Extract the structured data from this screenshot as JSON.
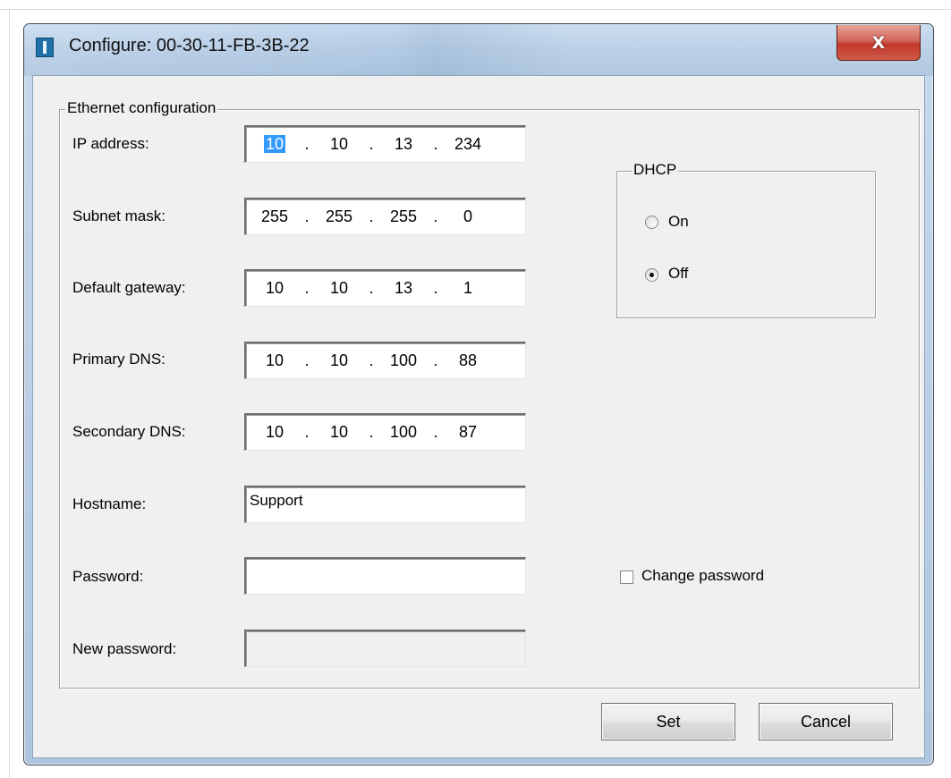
{
  "window": {
    "title": "Configure: 00-30-11-FB-3B-22",
    "close_label": "X"
  },
  "ethernet": {
    "group_label": "Ethernet configuration",
    "ip_address": {
      "label": "IP address:",
      "octets": [
        "10",
        "10",
        "13",
        "234"
      ]
    },
    "subnet_mask": {
      "label": "Subnet mask:",
      "octets": [
        "255",
        "255",
        "255",
        "0"
      ]
    },
    "default_gateway": {
      "label": "Default gateway:",
      "octets": [
        "10",
        "10",
        "13",
        "1"
      ]
    },
    "primary_dns": {
      "label": "Primary DNS:",
      "octets": [
        "10",
        "10",
        "100",
        "88"
      ]
    },
    "secondary_dns": {
      "label": "Secondary DNS:",
      "octets": [
        "10",
        "10",
        "100",
        "87"
      ]
    },
    "hostname": {
      "label": "Hostname:",
      "value": "Support"
    },
    "password": {
      "label": "Password:",
      "value": ""
    },
    "new_password": {
      "label": "New password:",
      "value": ""
    }
  },
  "dhcp": {
    "group_label": "DHCP",
    "on_label": "On",
    "off_label": "Off",
    "selected": "Off"
  },
  "change_password": {
    "label": "Change password",
    "checked": false
  },
  "buttons": {
    "set": "Set",
    "cancel": "Cancel"
  }
}
